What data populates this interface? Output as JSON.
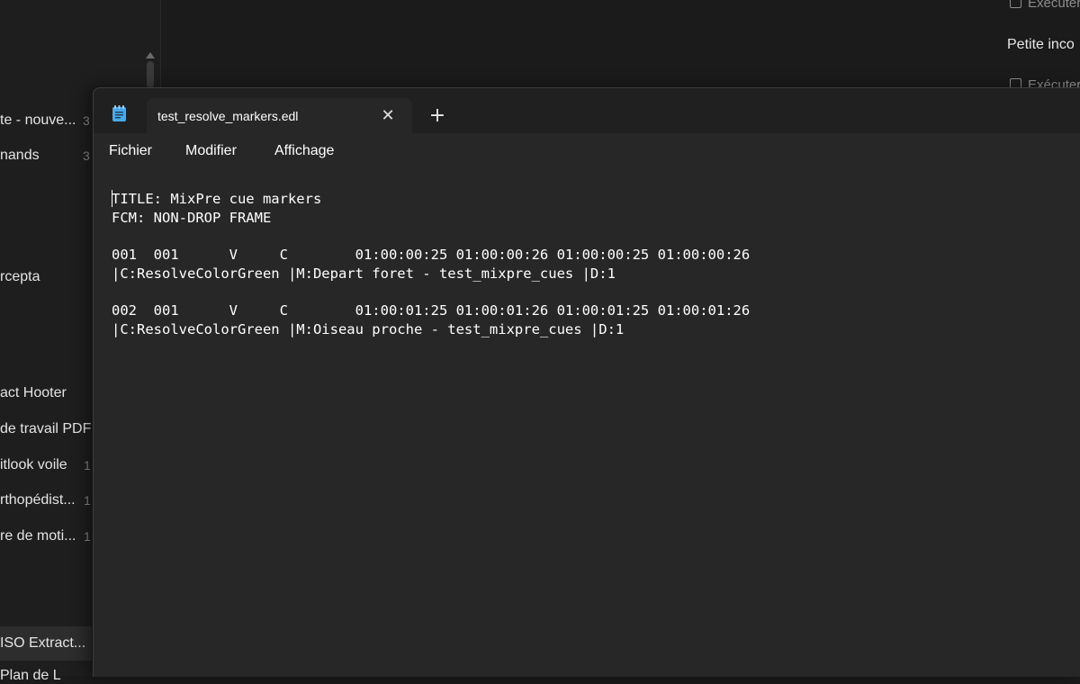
{
  "background_app": {
    "left_items": [
      {
        "label": "te - nouve...",
        "count": "3"
      },
      {
        "label": "nands",
        "count": "3"
      },
      {
        "label": "rcepta",
        "count": ""
      },
      {
        "label": "act Hooter",
        "count": ""
      },
      {
        "label": "de travail PDF",
        "count": ""
      },
      {
        "label": "itlook voile",
        "count": "1"
      },
      {
        "label": "rthopédist...",
        "count": "1"
      },
      {
        "label": "re de moti...",
        "count": "1"
      },
      {
        "label": "ISO Extract...",
        "count": ""
      },
      {
        "label": "Plan de L",
        "count": ""
      }
    ],
    "right_items": {
      "top": "Exécuter",
      "title": "Petite inco",
      "bottom": "Exécuter"
    }
  },
  "notepad": {
    "tab_title": "test_resolve_markers.edl",
    "close_glyph": "✕",
    "new_tab_glyph": "+",
    "menu": {
      "file": "Fichier",
      "edit": "Modifier",
      "view": "Affichage"
    },
    "content": "TITLE: MixPre cue markers\nFCM: NON-DROP FRAME\n\n001  001      V     C        01:00:00:25 01:00:00:26 01:00:00:25 01:00:00:26\n|C:ResolveColorGreen |M:Depart foret - test_mixpre_cues |D:1\n\n002  001      V     C        01:00:01:25 01:00:01:26 01:00:01:25 01:00:01:26\n|C:ResolveColorGreen |M:Oiseau proche - test_mixpre_cues |D:1"
  },
  "colors": {
    "window_bg": "#272727",
    "titlebar_bg": "#202020",
    "app_icon": "#4aa8e8"
  }
}
